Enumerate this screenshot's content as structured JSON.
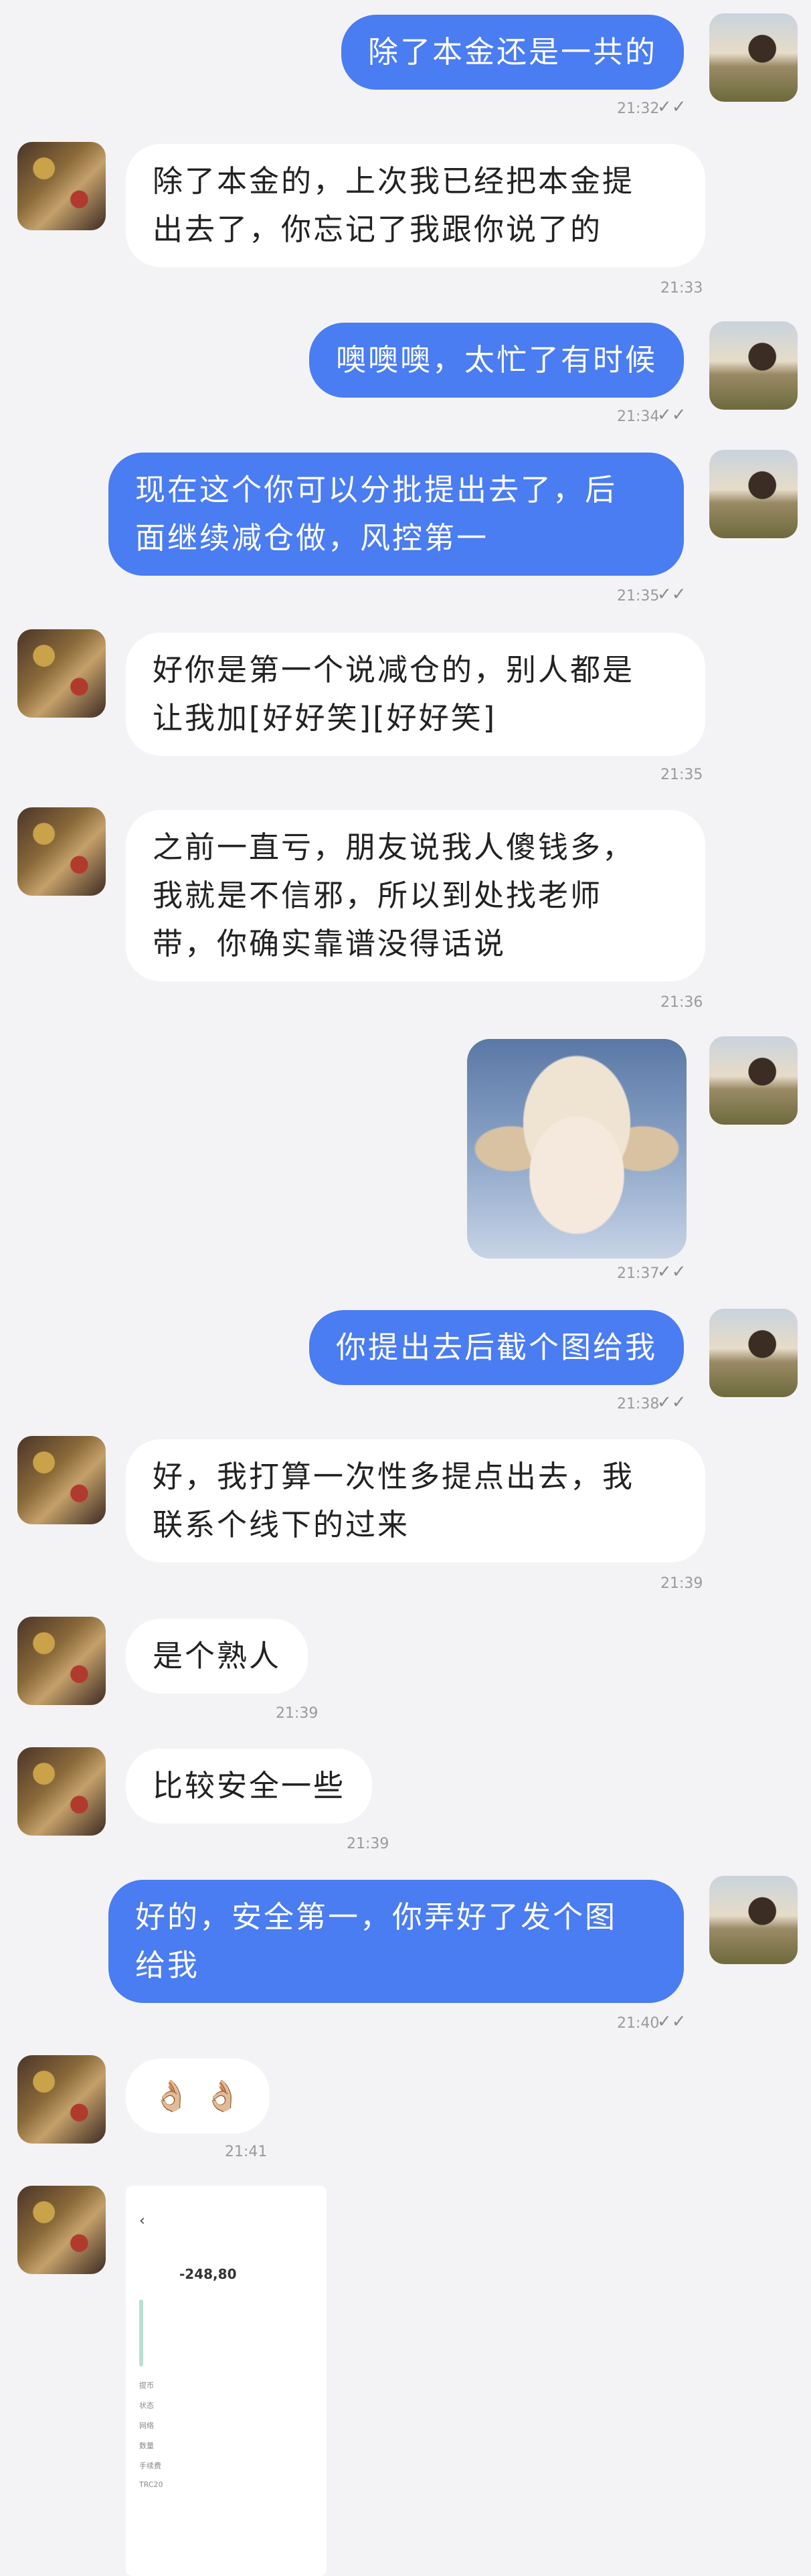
{
  "messages": [
    {
      "text": "除了本金还是一共的",
      "time": "21:32"
    },
    {
      "text": "除了本金的，上次我已经把本金提\n出去了，你忘记了我跟你说了的",
      "time": "21:33"
    },
    {
      "text": "噢噢噢，太忙了有时候",
      "time": "21:34"
    },
    {
      "text": "现在这个你可以分批提出去了，后\n面继续减仓做，风控第一",
      "time": "21:35"
    },
    {
      "text": "好你是第一个说减仓的，别人都是\n让我加[好好笑][好好笑]",
      "time": "21:35"
    },
    {
      "text": "之前一直亏，朋友说我人傻钱多，\n我就是不信邪，所以到处找老师\n带，你确实靠谱没得话说",
      "time": "21:36"
    },
    {
      "text": "",
      "time": "21:37"
    },
    {
      "text": "你提出去后截个图给我",
      "time": "21:38"
    },
    {
      "text": "好，我打算一次性多提点出去，我\n联系个线下的过来",
      "time": "21:39"
    },
    {
      "text": "是个熟人",
      "time": "21:39"
    },
    {
      "text": "比较安全一些",
      "time": "21:39"
    },
    {
      "text": "好的，安全第一，你弄好了发个图\n给我",
      "time": "21:40"
    },
    {
      "text": "👌🏼 👌🏼",
      "time": "21:41"
    }
  ],
  "receipt": {
    "back": "‹",
    "amount": "-248,80",
    "rows": [
      "提币",
      "状态",
      "网络",
      "数量",
      "手续费",
      "TRC20"
    ]
  }
}
